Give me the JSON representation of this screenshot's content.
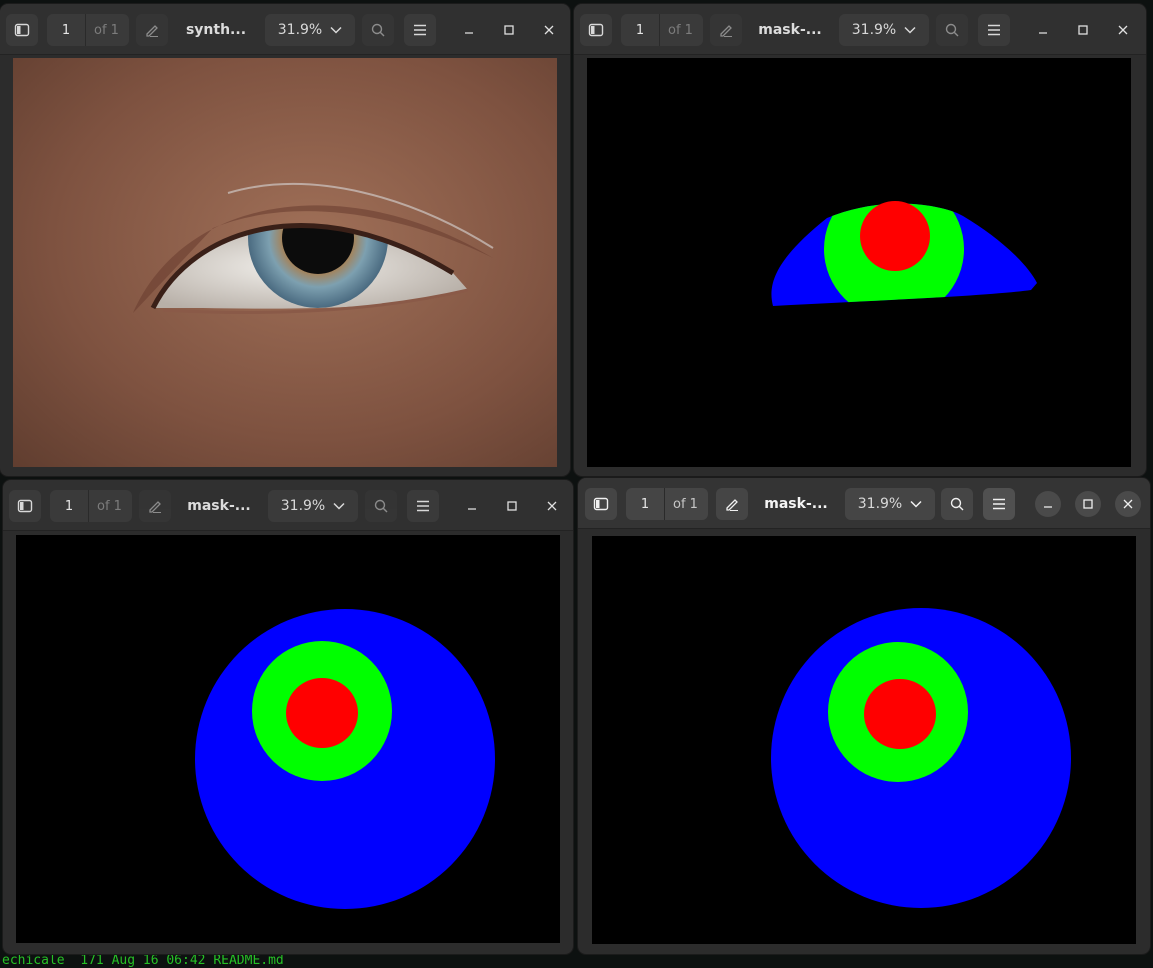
{
  "terminal": {
    "top_fragment": "",
    "bottom_line": "echicale  171 Aug 16 06:42 README.md"
  },
  "icons": {
    "sidebar": "sidebar-toggle-icon",
    "annotate": "pencil-annotate-icon",
    "search": "search-icon",
    "menu": "hamburger-menu-icon",
    "minimize": "minimize-icon",
    "maximize": "maximize-icon",
    "close": "close-icon",
    "dropdown": "chevron-down-icon"
  },
  "colors": {
    "mask_outer": "#0000ff",
    "mask_mid": "#00ff00",
    "mask_inner": "#ff0000",
    "mask_background": "#000000"
  },
  "windows": [
    {
      "title": "synth...",
      "page": "1",
      "page_of": "of 1",
      "zoom": "31.9%",
      "content": "synthetic eye photograph"
    },
    {
      "title": "mask-...",
      "page": "1",
      "page_of": "of 1",
      "zoom": "31.9%",
      "content": "segmentation mask"
    },
    {
      "title": "mask-...",
      "page": "1",
      "page_of": "of 1",
      "zoom": "31.9%",
      "content": "segmentation mask"
    },
    {
      "title": "mask-...",
      "page": "1",
      "page_of": "of 1",
      "zoom": "31.9%",
      "content": "segmentation mask",
      "active": true
    }
  ]
}
